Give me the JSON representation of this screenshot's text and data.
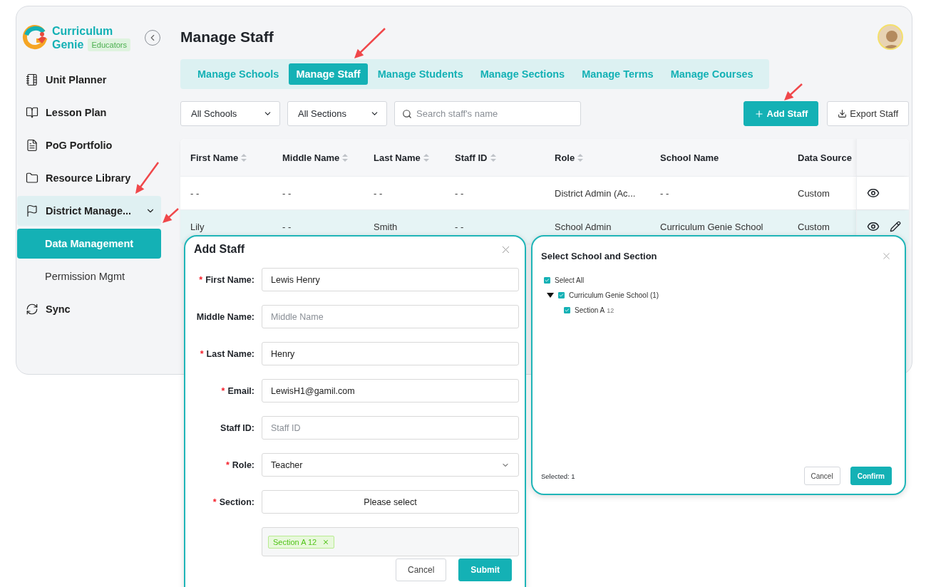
{
  "brand": {
    "name_line1": "Curriculum",
    "name_line2": "Genie",
    "badge": "Educators"
  },
  "sidebar": {
    "items": [
      {
        "label": "Unit Planner",
        "selected": false
      },
      {
        "label": "Lesson Plan",
        "selected": false
      },
      {
        "label": "PoG Portfolio",
        "selected": false
      },
      {
        "label": "Resource Library",
        "selected": false
      },
      {
        "label": "District Manage...",
        "selected": false,
        "expanded": true,
        "children": [
          {
            "label": "Data Management",
            "selected": true
          },
          {
            "label": "Permission Mgmt",
            "selected": false
          }
        ]
      },
      {
        "label": "Sync",
        "selected": false
      }
    ]
  },
  "page_title": "Manage Staff",
  "tabs": [
    {
      "label": "Manage Schools",
      "selected": false
    },
    {
      "label": "Manage Staff",
      "selected": true
    },
    {
      "label": "Manage Students",
      "selected": false
    },
    {
      "label": "Manage Sections",
      "selected": false
    },
    {
      "label": "Manage Terms",
      "selected": false
    },
    {
      "label": "Manage Courses",
      "selected": false
    }
  ],
  "filters": [
    {
      "value": "All Schools"
    },
    {
      "value": "All Sections"
    }
  ],
  "search": {
    "placeholder": "Search staff's name"
  },
  "actions": [
    {
      "label": "Add Staff",
      "kind": "primary"
    },
    {
      "label": "Export Staff",
      "kind": "export"
    }
  ],
  "table": {
    "columns": [
      {
        "label": "First Name",
        "sortable": true
      },
      {
        "label": "Middle Name",
        "sortable": true
      },
      {
        "label": "Last Name",
        "sortable": true
      },
      {
        "label": "Staff ID",
        "sortable": true
      },
      {
        "label": "Role",
        "sortable": true
      },
      {
        "label": "School Name",
        "sortable": false
      },
      {
        "label": "Data Source",
        "sortable": false
      }
    ],
    "rows": [
      {
        "cells": [
          "- -",
          "- -",
          "- -",
          "- -",
          "District Admin (Ac...",
          "- -",
          "Custom"
        ],
        "editable": false,
        "selected": false
      },
      {
        "cells": [
          "Lily",
          "- -",
          "Smith",
          "- -",
          "School Admin",
          "Curriculum Genie School",
          "Custom"
        ],
        "editable": true,
        "selected": true
      }
    ]
  },
  "add_staff_dialog": {
    "title": "Add Staff",
    "fields": [
      {
        "required_mark": "*",
        "label": "First Name:",
        "kind": "input",
        "value": "Lewis Henry"
      },
      {
        "label": "Middle Name:",
        "kind": "input",
        "placeholder": "Middle Name"
      },
      {
        "required_mark": "*",
        "label": "Last Name:",
        "kind": "input",
        "value": "Henry"
      },
      {
        "required_mark": "*",
        "label": "Email:",
        "kind": "input",
        "value": "LewisH1@gamil.com"
      },
      {
        "label": "Staff ID:",
        "kind": "input",
        "placeholder": "Staff ID"
      },
      {
        "required_mark": "*",
        "label": "Role:",
        "kind": "select",
        "value": "Teacher"
      },
      {
        "required_mark": "*",
        "label": "Section:",
        "kind": "picker",
        "value": "Please select"
      }
    ],
    "tags": [
      "Section A 12"
    ],
    "buttons": [
      {
        "label": "Cancel",
        "kind": "secondary"
      },
      {
        "label": "Submit",
        "kind": "primary"
      }
    ]
  },
  "select_dialog": {
    "title": "Select School and Section",
    "select_all": {
      "label": "Select All",
      "checked": true
    },
    "tree": [
      {
        "label": "Curriculum Genie School (1)",
        "checked": true,
        "expanded": true,
        "children": [
          {
            "label": "Section A",
            "count": "12",
            "checked": true
          }
        ]
      }
    ],
    "selected_count": "Selected: 1",
    "buttons": [
      {
        "label": "Cancel",
        "kind": "secondary"
      },
      {
        "label": "Confirm",
        "kind": "primary"
      }
    ]
  }
}
